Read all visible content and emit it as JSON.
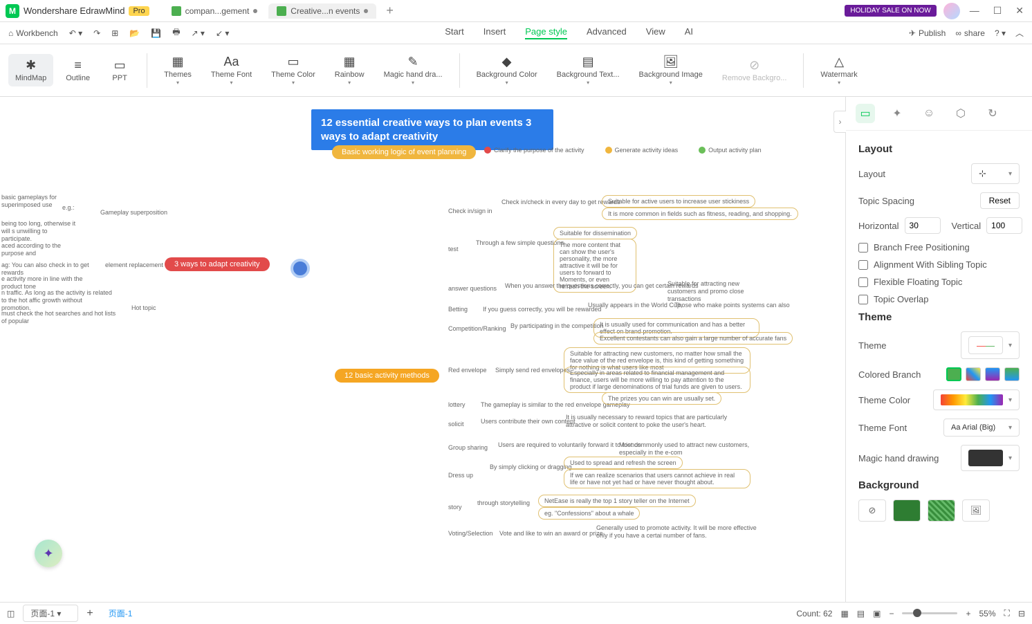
{
  "app": {
    "name": "Wondershare EdrawMind",
    "badge": "Pro",
    "sale": "HOLIDAY SALE ON NOW"
  },
  "tabs": [
    {
      "label": "compan...gement",
      "modified": true,
      "active": false
    },
    {
      "label": "Creative...n events",
      "modified": true,
      "active": true
    }
  ],
  "toolbar": {
    "workbench": "Workbench"
  },
  "menu": {
    "start": "Start",
    "insert": "Insert",
    "pagestyle": "Page style",
    "advanced": "Advanced",
    "view": "View",
    "ai": "AI",
    "publish": "Publish",
    "share": "share"
  },
  "ribbon": {
    "mindmap": "MindMap",
    "outline": "Outline",
    "ppt": "PPT",
    "themes": "Themes",
    "themefont": "Theme Font",
    "themecolor": "Theme Color",
    "rainbow": "Rainbow",
    "magichand": "Magic hand dra...",
    "bgcolor": "Background Color",
    "bgtext": "Background Text...",
    "bgimage": "Background Image",
    "removebg": "Remove Backgro...",
    "watermark": "Watermark"
  },
  "mindmap": {
    "title": "12 essential creative ways to plan events 3 ways to adapt creativity",
    "branch1": "Basic working logic of event planning",
    "branch2": "12 basic activity methods",
    "branch3": "3 ways to adapt creativity",
    "legend": {
      "a": "Clarify the purpose of the activity",
      "b": "Generate activity ideas",
      "c": "Output activity plan"
    },
    "left": {
      "n1": "basic gameplays for superimposed use",
      "n2": "e.g.:",
      "n3": "Gameplay superposition",
      "n4": "being too long, otherwise it will s unwilling to participate.",
      "n5": "aced according to the purpose and",
      "n6": "ag: You can also check in to get rewards",
      "n7": "element replacement",
      "n8": "e activity more in line with the product tone",
      "n9": "n traffic. As long as the activity is related to the hot affic growth without promotion.",
      "n10": "Hot topic",
      "n11": "must check the hot searches and hot lists of popular"
    },
    "right": {
      "checkin": {
        "label": "Check in/sign in",
        "sub1": "Check in/check in every day to get rewards",
        "note1": "Suitable for active users to increase user stickiness",
        "note2": "It is more common in fields such as fitness, reading, and shopping."
      },
      "test": {
        "label": "test",
        "sub1": "Through a few simple questions",
        "note1": "Suitable for dissemination",
        "note2": "The more content that can show the user's personality, the more attractive it will be for users to forward to Moments, or even refresh the screen."
      },
      "answer": {
        "label": "answer questions",
        "sub1": "When you answer the questions correctly, you can get certain rewards",
        "note1": "Suitable for attracting new customers and promo close transactions"
      },
      "betting": {
        "label": "Betting",
        "sub1": "If you guess correctly, you will be rewarded",
        "note1": "Usually appears in the World Cup,",
        "note2": "Those who make points systems can also"
      },
      "comp": {
        "label": "Competition/Ranking",
        "sub1": "By participating in the competition",
        "note1": "It is usually used for communication and has a better effect on brand promotion.",
        "note2": "Excellent contestants can also gain a large number of accurate fans"
      },
      "red": {
        "label": "Red envelope",
        "sub1": "Simply send red envelopes",
        "note1": "Suitable for attracting new customers, no matter how small the face value of the red envelope is, this kind of getting something for nothing is what users like most",
        "note2": "Especially in areas related to financial management and finance, users will be more willing to pay attention to the product if large denominations of trial funds are given to users."
      },
      "lottery": {
        "label": "lottery",
        "sub1": "The gameplay is similar to the red envelope gameplay",
        "note1": "The prizes you can win are usually set."
      },
      "solicit": {
        "label": "solicit",
        "sub1": "Users contribute their own content",
        "note1": "It is usually necessary to reward topics that are particularly attractive or solicit content to poke the user's heart."
      },
      "group": {
        "label": "Group sharing",
        "sub1": "Users are required to voluntarily forward it to friends",
        "note1": "Most commonly used to attract new customers, especially in the e-com"
      },
      "dress": {
        "label": "Dress up",
        "sub1": "By simply clicking or dragging",
        "note1": "Used to spread and refresh the screen",
        "note2": "If we can realize scenarios that users cannot achieve in real life or have not yet had or have never thought about."
      },
      "story": {
        "label": "story",
        "sub1": "through storytelling",
        "note1": "NetEase is really the top 1 story teller on the Internet",
        "note2": "eg. \"Confessions\" about a whale"
      },
      "voting": {
        "label": "Voting/Selection",
        "sub1": "Vote and like to win an award or prize",
        "note1": "Generally used to promote activity. It will be more effective only if you have a certai number of fans."
      }
    }
  },
  "panel": {
    "layout_title": "Layout",
    "layout_label": "Layout",
    "spacing_label": "Topic Spacing",
    "reset": "Reset",
    "horizontal": "Horizontal",
    "hval": "30",
    "vertical": "Vertical",
    "vval": "100",
    "cb1": "Branch Free Positioning",
    "cb2": "Alignment With Sibling Topic",
    "cb3": "Flexible Floating Topic",
    "cb4": "Topic Overlap",
    "theme_title": "Theme",
    "theme_label": "Theme",
    "colored_branch": "Colored Branch",
    "theme_color": "Theme Color",
    "theme_font": "Theme Font",
    "font_value": "Arial (Big)",
    "magic_hand": "Magic hand drawing",
    "background_title": "Background"
  },
  "status": {
    "page_dd": "页面-1",
    "page_tab": "页面-1",
    "count_label": "Count:",
    "count_val": "62",
    "zoom": "55%"
  }
}
